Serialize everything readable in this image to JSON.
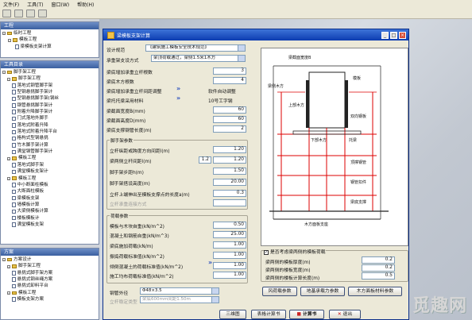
{
  "menu": [
    "文件(F)",
    "工具(T)",
    "窗口(W)",
    "帮助(H)"
  ],
  "panel1": {
    "title": "工程",
    "items": [
      "临时工程",
      "模板工程",
      "梁模板支架计算"
    ]
  },
  "panel2": {
    "title": "工具目录",
    "items": [
      "脚手架工程",
      "脚手架工程",
      "落地式钢管脚手架",
      "型钢悬挑脚手架计",
      "型钢悬挑脚手架(钢丝",
      "钢管悬挑脚手架计",
      "附着升降脚手架计",
      "门式落地外脚手",
      "落地式附着升降",
      "落地式附着升降平台",
      "格构式型钢悬挑",
      "竹木脚手架计算",
      "满堂钢管脚手架计",
      "模板工程",
      "落地式脚手架",
      "满堂模板支架计",
      "模板工程",
      "中小断面柱模板",
      "大断面柱模板",
      "梁模板支架",
      "墙模板计算",
      "大梁侧模板计算",
      "楼板模板计",
      "满堂模板支架"
    ]
  },
  "panel3": {
    "title": "方案",
    "items": [
      "方案设计",
      "脚手架工程",
      "悬挑式脚手架方案",
      "悬挑式钢丝绳方案",
      "悬挑式卸料平台",
      "模板工程",
      "模板支架方案"
    ]
  },
  "dialog": {
    "title": "梁模板支架计算",
    "spec_label": "设计规范",
    "spec_value": "《建筑施工模板安全技术规范》",
    "method_label": "承重架支设方式",
    "method_value": "梁顶荷载通过，梁侧1.5米1木方",
    "rows": [
      {
        "label": "梁底增加承重立杆根数",
        "value": "3"
      },
      {
        "label": "梁底木方根数",
        "value": "4"
      },
      {
        "label": "梁底增加承重立杆间距调整",
        "value": "软件自动调整"
      },
      {
        "label": "梁托托梁采用材料",
        "value": "10号工字钢"
      },
      {
        "label": "梁截面宽度B(mm)",
        "value": "60"
      },
      {
        "label": "梁截面高度D(mm)",
        "value": "60"
      },
      {
        "label": "梁底支撑钢管长度(m)",
        "value": "2"
      }
    ],
    "scaffold_group": "脚手架参数",
    "scaffold_rows": [
      {
        "label": "立杆纵距或跨度方向间距l(m)",
        "value": "1.20"
      },
      {
        "label": "梁两侧立杆间距l(m)",
        "value": "1.2",
        "value2": "1.20"
      },
      {
        "label": "脚手架步距h(m)",
        "value": "1.50"
      },
      {
        "label": "脚手架搭设高度(m)",
        "value": "20.00"
      },
      {
        "label": "立杆上端伸出至模板支撑点的长度a(m)",
        "value": "0.3"
      },
      {
        "label": "立杆承重连接方式",
        "value": ""
      }
    ],
    "load_group": "荷载参数",
    "load_rows": [
      {
        "label": "模板与木块自重(kN/m^2)",
        "value": "0.50"
      },
      {
        "label": "混凝土和钢筋自重(kN/m^3)",
        "value": "25.00"
      },
      {
        "label": "梁底施加荷载(kN/m)",
        "value": "1.00"
      },
      {
        "label": "振捣荷载标准值(kN/m^2)",
        "value": "1.00"
      },
      {
        "label": "倾倒混凝土的荷载标准值(kN/m^2)",
        "value": "1.00"
      },
      {
        "label": "施工均布荷载标准值(kN/m^2)",
        "value": "1.00"
      }
    ],
    "pipe_label": "钢管外径",
    "pipe_value": "Φ48×3.5",
    "pipe2_label": "立杆稳定类型",
    "pipe2_value": "梁底600mm间距1.50m",
    "side": {
      "check_label": "是否考虑梁两侧的模板荷载",
      "r1_label": "梁两侧的模板厚度(m)",
      "r1_value": "0.2",
      "r2_label": "梁两侧的楼板宽度(m)",
      "r2_value": "0.2",
      "r3_label": "梁两侧的楼板计算长度(m)",
      "r3_value": "0.5"
    },
    "buttons": [
      "风荷载参数",
      "地基承载力参数",
      "木方面板材料参数"
    ],
    "bottom_buttons": [
      "三维图",
      "表格计算书",
      "计算书",
      "退出"
    ]
  },
  "drawing": {
    "labels": [
      "梁截面宽度B",
      "模板",
      "梁侧木方",
      "上部木方",
      "双向钢板",
      "下部木方",
      "托梁",
      "顶撑钢管",
      "钢管扣件",
      "梁底支撑",
      "木方面板支座",
      "钢管外径",
      "梁截面高度",
      "纵距/横距"
    ]
  },
  "watermark": "觅趣网"
}
